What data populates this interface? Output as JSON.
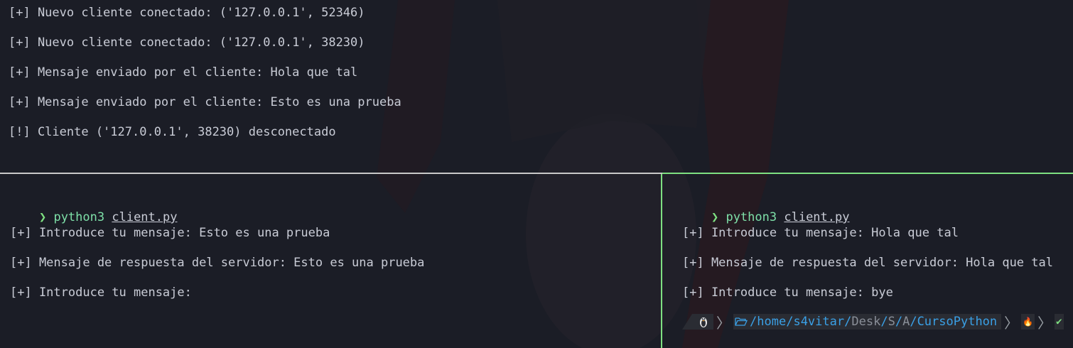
{
  "server_pane": {
    "lines": [
      "[+] Nuevo cliente conectado: ('127.0.0.1', 52346)",
      "[+] Nuevo cliente conectado: ('127.0.0.1', 38230)",
      "[+] Mensaje enviado por el cliente: Hola que tal",
      "[+] Mensaje enviado por el cliente: Esto es una prueba",
      "[!] Cliente ('127.0.0.1', 38230) desconectado"
    ]
  },
  "client_left": {
    "prompt_symbol": "❯",
    "command": "python3",
    "argument": "client.py",
    "lines": [
      "[+] Introduce tu mensaje: Esto es una prueba",
      "[+] Mensaje de respuesta del servidor: Esto es una prueba",
      "[+] Introduce tu mensaje:"
    ]
  },
  "client_right": {
    "prompt_symbol": "❯",
    "command": "python3",
    "argument": "client.py",
    "lines": [
      "[+] Introduce tu mensaje: Hola que tal",
      "[+] Mensaje de respuesta del servidor: Hola que tal",
      "[+] Introduce tu mensaje: bye"
    ],
    "powerline": {
      "os_icon": "linux-tux-icon",
      "folder_icon": "folder-open-icon",
      "path_home": "home",
      "path_user": "s4vitar",
      "path_desk": "Desk",
      "path_s": "S",
      "path_a": "A",
      "path_last": "CursoPython",
      "slash": "/",
      "flame_glyph": "🔥",
      "check_glyph": "✔"
    }
  },
  "colors": {
    "background": "#1b1d26",
    "text": "#c9ccd6",
    "active_border": "#7ee081",
    "path_blue": "#3aa0e6"
  }
}
